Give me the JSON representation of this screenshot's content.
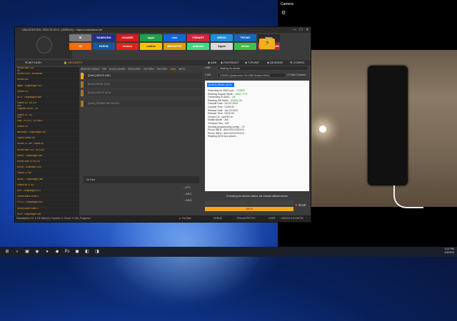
{
  "window": {
    "title": "UNLOCKTOOL 2022.01.09.0 - [DEBUG] - https://unlocktool.net",
    "help_glyph": "?",
    "minimize": "—",
    "maximize": "☐",
    "close": "✕"
  },
  "brands": [
    {
      "label": "⚙",
      "color": "#7a7a7a"
    },
    {
      "label": "SAMSUNG",
      "color": "#1f2f8f"
    },
    {
      "label": "HUAWEI",
      "color": "#d11c1c"
    },
    {
      "label": "oppo",
      "color": "#19a34a"
    },
    {
      "label": "vivo",
      "color": "#1467d9"
    },
    {
      "label": "VSMART",
      "color": "#d4233f"
    },
    {
      "label": "MEIZU",
      "color": "#1b8fe0"
    },
    {
      "label": "TECNO",
      "color": "#1565c0"
    },
    {
      "label": "/asus",
      "color": "#2a2a2a"
    },
    {
      "label": "MI",
      "color": "#ff6a00"
    },
    {
      "label": "NOKIA",
      "color": "#1257a9"
    },
    {
      "label": "lenovo",
      "color": "#e2231a"
    },
    {
      "label": "realme",
      "color": "#f5c400"
    },
    {
      "label": "MEDIATEK",
      "color": "#d6a000"
    },
    {
      "label": "android",
      "color": "#3ddc84"
    },
    {
      "label": " Apple",
      "color": "#d8d8d8"
    },
    {
      "label": "Infinix",
      "color": "#3ac24a"
    },
    {
      "label": "SPREADTRUM",
      "color": "#c91f37"
    }
  ],
  "nav": {
    "mi_flash": "MI FLASH",
    "security": "SECURITY",
    "usb": "USB",
    "usb_value": "Waiting for device",
    "adb": "ADB",
    "fastboot": "FASTBOOT",
    "tpoint": "T-POINT",
    "devmgr": "DEVMGR",
    "config": "CONFIG",
    "com": "COM",
    "com_value": "COM29 (Qualcomm HS-USB Modem 9091)",
    "fast_connect": "Fast Connect"
  },
  "left_list": [
    {
      "line1": "Redmi Note 11S",
      "line2": "lite"
    },
    {
      "line1": "Redmi K30S - MSM8998",
      "line2": ""
    },
    {
      "line1": "Redmi K40",
      "line2": ""
    },
    {
      "line1": "agate - Snapdragon 410",
      "line2": ""
    },
    {
      "line1": "Redmi K11",
      "line2": ""
    },
    {
      "line1": "Mi 11 - Snapdragon 888",
      "line2": ""
    },
    {
      "line1": "Xiaomi 11i - Mi 11X",
      "line2": "new"
    },
    {
      "line1": "Pipspirin 4G/5G - 55",
      "line2": ""
    },
    {
      "line1": "Xiaomi 11T 5G",
      "line2": "new"
    },
    {
      "line1": "onyx - AT2212 - MTK6877",
      "line2": ""
    },
    {
      "line1": "Xiaomi 11T",
      "line2": ""
    },
    {
      "line1": "dandelion - Snapdragon 460",
      "line2": ""
    },
    {
      "line1": "Xiaomi Redmi 9A",
      "line2": ""
    },
    {
      "line1": "Redmi 10 - lite - Sweet 5G",
      "line2": ""
    },
    {
      "line1": "Redmi Note 10S - MT6785",
      "line2": ""
    },
    {
      "line1": "monet - Snapdragon 865",
      "line2": ""
    },
    {
      "line1": "Redmi Note 10 Pro 5G",
      "line2": ""
    },
    {
      "line1": "HANN - Dimensity 1200",
      "line2": ""
    },
    {
      "line1": "Xiaomi 11 Lite",
      "line2": ""
    },
    {
      "line1": "BIANC - Snapdragon 888",
      "line2": ""
    },
    {
      "line1": "Xiaomi Mi 11 5G",
      "line2": ""
    },
    {
      "line1": "SEK - Snapdragon 870",
      "line2": ""
    },
    {
      "line1": "Xiaomi Black Shark 4",
      "line2": ""
    },
    {
      "line1": "POCO - Snapdragon 662",
      "line2": ""
    },
    {
      "line1": "Redmi Black Shark 3",
      "line2": ""
    },
    {
      "line1": "HHR - Snapdragon 865",
      "line2": ""
    },
    {
      "line1": "Xiaomi Mi 10 Ultra",
      "line2": ""
    },
    {
      "line1": "XIGO - Snapdragon 865",
      "line2": ""
    },
    {
      "line1": "Xiaomi Mi Note 10",
      "line2": ""
    },
    {
      "line1": "Redmi 9C - MT6762",
      "line2": ""
    },
    {
      "line1": "Xiaomi Redmi 9 Power",
      "line2": ""
    },
    {
      "line1": "REC - Snapdragon 675",
      "line2": ""
    },
    {
      "line1": "Xiaomi Redmi 9T",
      "line2": ""
    },
    {
      "line1": "ROLEX - Snapdragon 662",
      "line2": ""
    },
    {
      "line1": "Xiaomi Redmi K10 Pro",
      "line2": ""
    },
    {
      "line1": "AVIA - Snapdragon 865",
      "line2": ""
    },
    {
      "line1": "Xiaomi Redmi Note 9",
      "line2": ""
    }
  ],
  "tabs": [
    "REMOTE CODES",
    "FRP",
    "BOOTLOADER",
    "RECOVERY",
    "PATTERN",
    "FACTORY",
    "DIAG",
    "META"
  ],
  "mid": {
    "item1": "[DIAG] WRITE IMEI",
    "item2": "[DIAG] READ QCN",
    "item3": "[DIAG] WRITE QCN",
    "item4": "[DIAG] REPAIR NETWORK",
    "log_label": "All Data",
    "opt1": "EFS",
    "opt2": "IMEI1",
    "opt3": "IMEI2"
  },
  "console": {
    "header": "[DIAG] READ QCN",
    "lines": [
      {
        "k": "Searching for DIAG port...",
        "v": "COM29"
      },
      {
        "k": "Reading Support Mode...",
        "v": "DIAG, FTS"
      },
      {
        "k": "Connecting to DIAG...",
        "v": "OK"
      },
      {
        "k": "Reading SW Mode...",
        "v": "[DIAG] OK"
      },
      {
        "k": "Compile Date : Oct 12 2022",
        "v": ""
      },
      {
        "k": "Compile Time : 21:55:30",
        "v": ""
      },
      {
        "k": "Release Date : Jan 23 2022",
        "v": ""
      },
      {
        "k": "Release Time : 06:00:00",
        "v": ""
      },
      {
        "k": "Version Dir : sdxPRJ.lb",
        "v": ""
      },
      {
        "k": "Mobile Model : 255",
        "v": ""
      },
      {
        "k": "Firmware Rev : 600",
        "v": ""
      },
      {
        "k": "Sending programming config...",
        "v": "OK"
      },
      {
        "k": "Phone IMEI1 : 86XXXXXXXXXXX",
        "v": ""
      },
      {
        "k": "Phone IMEI2 : 86XXXXXXXXXXX",
        "v": ""
      },
      {
        "k": "Reading QCN from phone...",
        "v": ""
      }
    ]
  },
  "status": {
    "checking": "Checking for device status via Xiaomi official server",
    "progress1": 0,
    "progress1_label": "0 %",
    "progress2": 100,
    "progress2_label": "100 %",
    "stop": "STOP"
  },
  "statusbar": {
    "left": "Subscription: ID: 6 YN Valid (0), Function: 0, Event: 0 <NV_Progress>",
    "youtube": "YouTube",
    "debug": "DEBUG",
    "host": "TiPhoneTEST-PC",
    "user": "USER",
    "datetime": "1/9/2023 9:22:09 PM"
  },
  "camera": {
    "title": "Camera",
    "gear": "⚙"
  },
  "taskbar": {
    "time": "9:22 PM",
    "date": "1/9/2023",
    "icons": [
      "⊞",
      "⌕",
      "▣",
      "◉",
      "●",
      "◆",
      "Ps",
      "◼",
      "◧",
      "◨"
    ]
  }
}
